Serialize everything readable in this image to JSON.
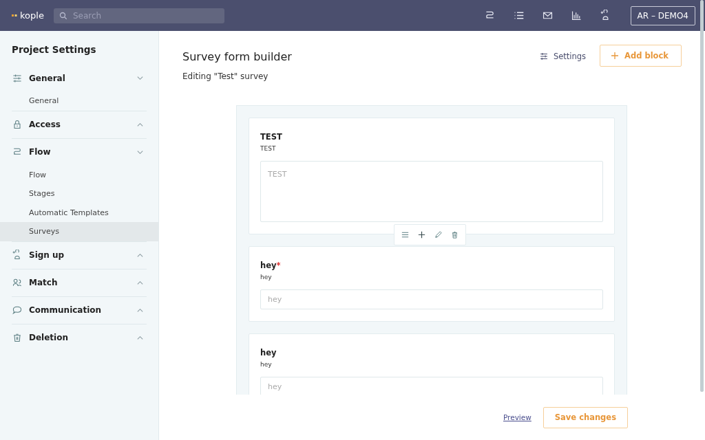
{
  "topbar": {
    "logo": "kople",
    "search": {
      "placeholder": "Search"
    },
    "account": "AR – DEMO4"
  },
  "sidebar": {
    "title": "Project Settings",
    "groups": [
      {
        "label": "General",
        "expanded": true,
        "items": [
          {
            "label": "General",
            "selected": false
          }
        ]
      },
      {
        "label": "Access",
        "expanded": false
      },
      {
        "label": "Flow",
        "expanded": true,
        "items": [
          {
            "label": "Flow",
            "selected": false
          },
          {
            "label": "Stages",
            "selected": false
          },
          {
            "label": "Automatic Templates",
            "selected": false
          },
          {
            "label": "Surveys",
            "selected": true
          }
        ]
      },
      {
        "label": "Sign up",
        "expanded": false
      },
      {
        "label": "Match",
        "expanded": false
      },
      {
        "label": "Communication",
        "expanded": false
      },
      {
        "label": "Deletion",
        "expanded": false
      }
    ]
  },
  "page": {
    "title": "Survey form builder",
    "subtitle": "Editing \"Test\" survey",
    "settings_button": "Settings",
    "add_button": "Add block"
  },
  "blocks": [
    {
      "kind": "textarea",
      "title": "TEST",
      "description": "TEST",
      "placeholder": "TEST",
      "toolbar": true
    },
    {
      "kind": "input",
      "title": "hey",
      "required_mark": "*",
      "description": "hey",
      "placeholder": "hey"
    },
    {
      "kind": "input",
      "title": "hey",
      "description": "hey",
      "placeholder": "hey"
    }
  ],
  "footer": {
    "preview": "Preview",
    "save": "Save changes"
  }
}
